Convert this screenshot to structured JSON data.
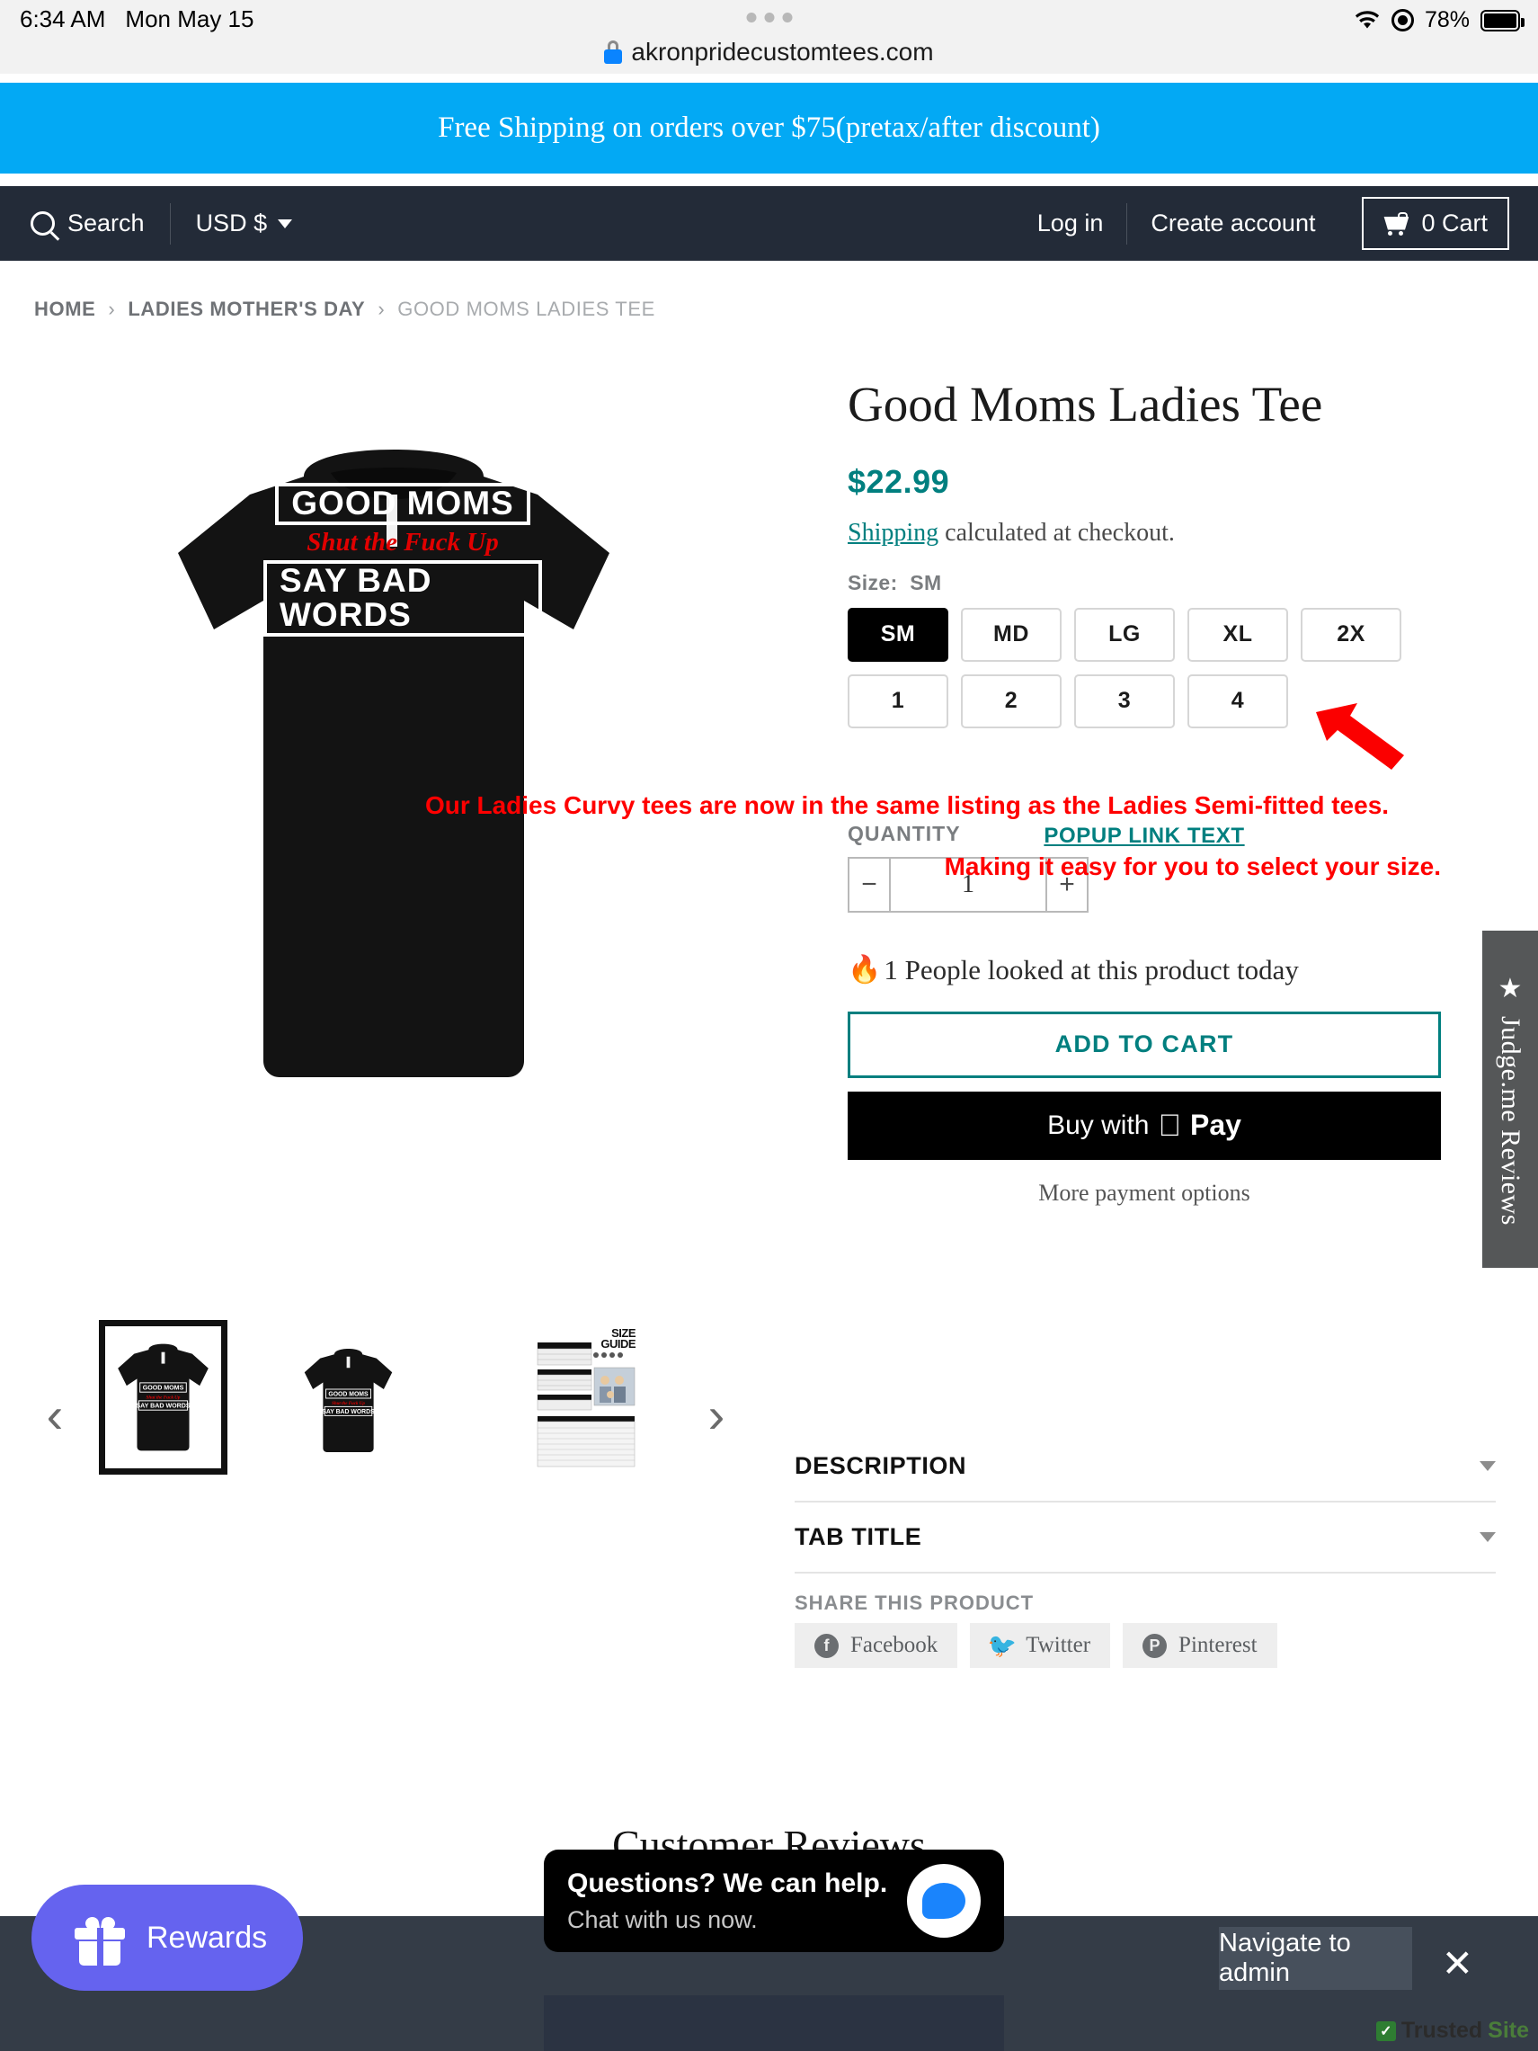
{
  "statusbar": {
    "time": "6:34 AM",
    "date": "Mon May 15",
    "battery": "78%",
    "wifi_icon": "wifi-icon",
    "location_icon": "location-icon",
    "battery_icon": "battery-icon"
  },
  "browser": {
    "url": "akronpridecustomtees.com",
    "lock_icon": "lock-icon"
  },
  "promo": {
    "text": "Free Shipping on orders over $75(pretax/after discount)",
    "bg": "#03A9F4"
  },
  "nav": {
    "search_label": "Search",
    "currency": "USD $",
    "login": "Log in",
    "create_account": "Create account",
    "cart": "0 Cart",
    "bg": "#232b38"
  },
  "breadcrumb": {
    "items": [
      {
        "label": "HOME",
        "current": false
      },
      {
        "label": "LADIES MOTHER'S DAY",
        "current": false
      },
      {
        "label": "GOOD MOMS LADIES TEE",
        "current": true
      }
    ],
    "separator": "›"
  },
  "product": {
    "title": "Good Moms Ladies Tee",
    "price": "$22.99",
    "price_color": "#007f7f",
    "shipping_link": "Shipping",
    "shipping_rest": " calculated at checkout.",
    "size_label": "Size:",
    "size_selected": "SM",
    "sizes_row1": [
      "SM",
      "MD",
      "LG",
      "XL",
      "2X"
    ],
    "sizes_row2": [
      "1",
      "2",
      "3",
      "4"
    ],
    "quantity_label": "QUANTITY",
    "quantity_value": "1",
    "quantity_minus": "−",
    "quantity_plus": "+",
    "viewers_text": "1 People looked at this product today",
    "flame_icon": "flame-icon",
    "add_to_cart": "ADD TO CART",
    "buy_with": "Buy with",
    "apple_pay": "Pay",
    "apple_logo": "",
    "more_payment": "More payment options"
  },
  "overlay": {
    "red_line_1": "Our Ladies Curvy tees are now in the same listing as the Ladies Semi-fitted tees.",
    "popup_link": "POPUP LINK TEXT",
    "red_line_2": "Making it easy for you to select your size.",
    "red_color": "#ff0000",
    "arrow_icon": "red-arrow-icon"
  },
  "artwork": {
    "line1": "GOOD MOMS",
    "line2": "Shut the Fuck Up",
    "line3": "SAY BAD WORDS"
  },
  "gallery": {
    "prev_icon": "chevron-left-icon",
    "next_icon": "chevron-right-icon",
    "thumbnails": [
      {
        "name": "thumbnail-front-tee",
        "selected": true
      },
      {
        "name": "thumbnail-tee-alt",
        "selected": false
      },
      {
        "name": "thumbnail-size-guide",
        "selected": false
      }
    ],
    "size_guide_title_1": "SIZE",
    "size_guide_title_2": "GUIDE"
  },
  "accordion": [
    {
      "title": "DESCRIPTION",
      "expanded": false
    },
    {
      "title": "TAB TITLE",
      "expanded": false
    }
  ],
  "share": {
    "label": "SHARE THIS PRODUCT",
    "buttons": [
      {
        "label": "Facebook",
        "icon": "facebook-icon",
        "glyph": "f"
      },
      {
        "label": "Twitter",
        "icon": "twitter-icon",
        "glyph": "🐦"
      },
      {
        "label": "Pinterest",
        "icon": "pinterest-icon",
        "glyph": "P"
      }
    ]
  },
  "reviews": {
    "heading": "Customer Reviews",
    "stars": [
      "★",
      "★",
      "★",
      "★",
      "★"
    ],
    "judgeme_tab": "Judge.me Reviews",
    "judgeme_star": "★"
  },
  "widgets": {
    "rewards_label": "Rewards",
    "rewards_icon": "gift-icon",
    "rewards_bg": "#6563ef",
    "chat_title": "Questions? We can help.",
    "chat_sub": "Chat with us now.",
    "chat_icon": "chat-bubble-icon",
    "navigate_admin": "Navigate to admin",
    "close_icon": "close-icon",
    "trusted_1": "Trusted",
    "trusted_2": "Site",
    "trusted_icon": "trustedsite-check-icon"
  }
}
